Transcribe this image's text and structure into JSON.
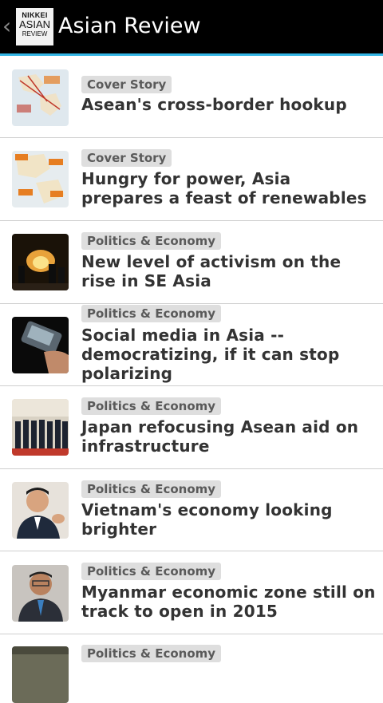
{
  "app": {
    "logo": {
      "line1": "NIKKEI",
      "line2": "ASIAN",
      "line3": "REVIEW"
    },
    "title": "Asian Review",
    "accent": "#33b5e5"
  },
  "articles": [
    {
      "category": "Cover Story",
      "title": "Asean's cross-border hookup",
      "image": "map-thumbnail"
    },
    {
      "category": "Cover Story",
      "title": "Hungry for power, Asia prepares a feast of renewables",
      "image": "map-thumbnail"
    },
    {
      "category": "Politics & Economy",
      "title": "New level of activism on the rise in SE Asia",
      "image": "protest-photo"
    },
    {
      "category": "Politics & Economy",
      "title": "Social media in Asia -- democratizing, if it can stop polarizing",
      "image": "phone-photo"
    },
    {
      "category": "Politics & Economy",
      "title": "Japan refocusing Asean aid on infrastructure",
      "image": "leaders-group-photo"
    },
    {
      "category": "Politics & Economy",
      "title": "Vietnam's economy looking brighter",
      "image": "portrait-photo"
    },
    {
      "category": "Politics & Economy",
      "title": "Myanmar economic zone still on track to open in 2015",
      "image": "portrait-photo"
    },
    {
      "category": "Politics & Economy",
      "title": "",
      "image": "photo"
    }
  ]
}
